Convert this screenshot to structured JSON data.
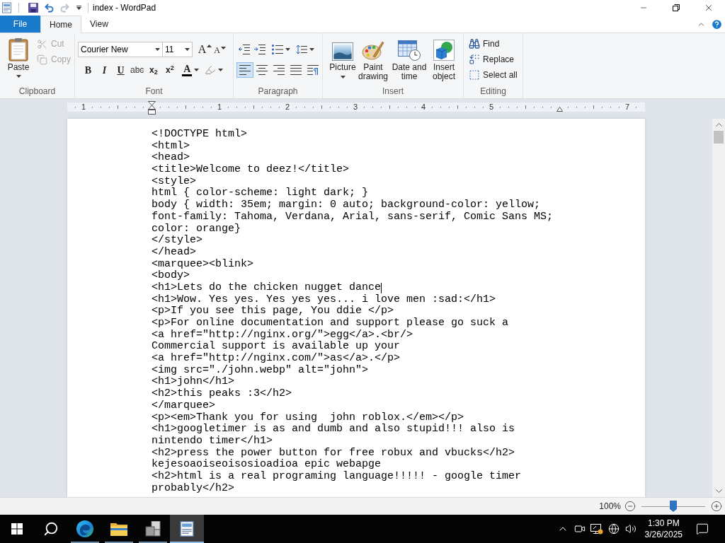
{
  "window": {
    "title": "index - WordPad"
  },
  "quick_access": [
    {
      "kind": "save",
      "disabled": false
    },
    {
      "kind": "undo",
      "disabled": false
    },
    {
      "kind": "redo",
      "disabled": true
    }
  ],
  "tabs": [
    {
      "label": "File",
      "kind": "menu",
      "selected": false
    },
    {
      "label": "Home",
      "kind": "tab",
      "selected": true
    },
    {
      "label": "View",
      "kind": "tab",
      "selected": false
    }
  ],
  "ribbon": {
    "clipboard": {
      "label": "Clipboard",
      "paste": "Paste",
      "items": [
        {
          "kind": "cut",
          "label": "Cut",
          "disabled": true
        },
        {
          "kind": "copy",
          "label": "Copy",
          "disabled": true
        }
      ]
    },
    "font": {
      "label": "Font",
      "family": "Courier New",
      "size": "11",
      "size_buttons": [
        {
          "kind": "grow",
          "glyph": "A"
        },
        {
          "kind": "shrink",
          "glyph": "A"
        }
      ],
      "format_buttons": [
        {
          "kind": "bold",
          "glyph": "B"
        },
        {
          "kind": "italic",
          "glyph": "I"
        },
        {
          "kind": "underline",
          "glyph": "U"
        },
        {
          "kind": "strikethrough",
          "glyph": "abc"
        },
        {
          "kind": "subscript",
          "glyph": "x$_{2}$"
        },
        {
          "kind": "superscript",
          "glyph": "x$^{2}$"
        }
      ],
      "font_color": {
        "glyph": "A",
        "color": "#000000"
      }
    },
    "paragraph": {
      "label": "Paragraph",
      "list_buttons": [
        {
          "kind": "decrease_indent",
          "menu": false
        },
        {
          "kind": "increase_indent",
          "menu": false
        },
        {
          "kind": "bullets",
          "menu": true
        },
        {
          "kind": "line_spacing",
          "menu": true
        }
      ],
      "align_buttons": [
        {
          "kind": "align_left",
          "selected": true
        },
        {
          "kind": "align_center",
          "selected": false
        },
        {
          "kind": "align_right",
          "selected": false
        },
        {
          "kind": "justify",
          "selected": false
        },
        {
          "kind": "paragraph",
          "selected": false
        }
      ]
    },
    "insert": {
      "label": "Insert",
      "items": [
        {
          "kind": "picture",
          "label": "Picture",
          "menu": true
        },
        {
          "kind": "paint",
          "label": "Paint drawing",
          "menu": false
        },
        {
          "kind": "datetime",
          "label": "Date and time",
          "menu": false
        },
        {
          "kind": "object",
          "label": "Insert object",
          "menu": false
        }
      ]
    },
    "editing": {
      "label": "Editing",
      "items": [
        {
          "kind": "find",
          "label": "Find"
        },
        {
          "kind": "replace",
          "label": "Replace"
        },
        {
          "kind": "select_all",
          "label": "Select all"
        }
      ]
    }
  },
  "ruler": {
    "labels": [
      "1",
      "1",
      "2",
      "3",
      "4",
      "5",
      "7"
    ]
  },
  "document": {
    "lines": [
      {
        "text": "<!DOCTYPE html>",
        "cursor": false
      },
      {
        "text": "<html>",
        "cursor": false
      },
      {
        "text": "<head>",
        "cursor": false
      },
      {
        "text": "<title>Welcome to deez!</title>",
        "cursor": false
      },
      {
        "text": "<style>",
        "cursor": false
      },
      {
        "text": "html { color-scheme: light dark; }",
        "cursor": false
      },
      {
        "text": "body { width: 35em; margin: 0 auto; background-color: yellow;",
        "cursor": false
      },
      {
        "text": "font-family: Tahoma, Verdana, Arial, sans-serif, Comic Sans MS;",
        "cursor": false
      },
      {
        "text": "color: orange}",
        "cursor": false
      },
      {
        "text": "</style>",
        "cursor": false
      },
      {
        "text": "</head>",
        "cursor": false
      },
      {
        "text": "<marquee><blink>",
        "cursor": false
      },
      {
        "text": "<body>",
        "cursor": false
      },
      {
        "text": "<h1>Lets do the chicken nugget dance",
        "cursor": true
      },
      {
        "text": "<h1>Wow. Yes yes. Yes yes yes... i love men :sad:</h1>",
        "cursor": false
      },
      {
        "text": "<p>If you see this page, You ddie </p>",
        "cursor": false
      },
      {
        "text": "<p>For online documentation and support please go suck a",
        "cursor": false
      },
      {
        "text": "<a href=\"http://nginx.org/\">egg</a>.<br/>",
        "cursor": false
      },
      {
        "text": "Commercial support is available up your",
        "cursor": false
      },
      {
        "text": "<a href=\"http://nginx.com/\">as</a>.</p>",
        "cursor": false
      },
      {
        "text": "<img src=\"./john.webp\" alt=\"john\">",
        "cursor": false
      },
      {
        "text": "<h1>john</h1>",
        "cursor": false
      },
      {
        "text": "<h2>this peaks :3</h2>",
        "cursor": false
      },
      {
        "text": "</marquee>",
        "cursor": false
      },
      {
        "text": "<p><em>Thank you for using  john roblox.</em></p>",
        "cursor": false
      },
      {
        "text": "<h1>googletimer is as and dumb and also stupid!!! also is",
        "cursor": false
      },
      {
        "text": "nintendo timer</h1>",
        "cursor": false
      },
      {
        "text": "<h2>press the power button for free robux and vbucks</h2>",
        "cursor": false
      },
      {
        "text": "kejesoaoiseoisosioadioa epic webapge",
        "cursor": false
      },
      {
        "text": "<h2>html is a real programing language!!!!! - google timer",
        "cursor": false
      },
      {
        "text": "probably</h2>",
        "cursor": false
      }
    ]
  },
  "status_bar": {
    "zoom": {
      "reading": "100%",
      "level": 0.5
    }
  },
  "taskbar": {
    "apps": [
      {
        "kind": "browser",
        "running": true,
        "selected": false
      },
      {
        "kind": "folder",
        "running": true,
        "selected": false
      },
      {
        "kind": "blocks",
        "running": true,
        "selected": false
      },
      {
        "kind": "document",
        "running": true,
        "selected": true
      }
    ],
    "clock": {
      "time": "1:30 PM",
      "date": "3/26/2025"
    }
  }
}
